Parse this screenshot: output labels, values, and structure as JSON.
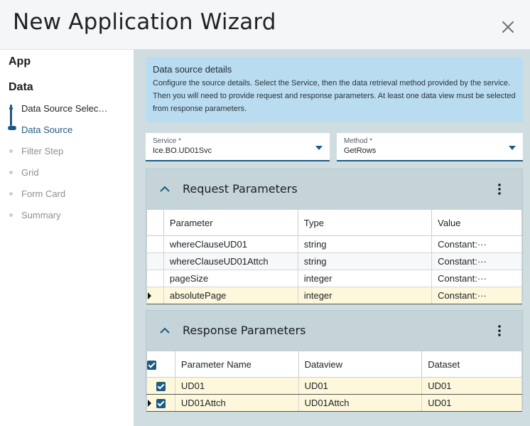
{
  "window": {
    "title": "New Application Wizard"
  },
  "sidebar": {
    "sections": [
      "App",
      "Data"
    ],
    "steps": [
      {
        "label": "Data Source Selec…",
        "state": "done"
      },
      {
        "label": "Data Source",
        "state": "active"
      },
      {
        "label": "Filter Step",
        "state": "pending"
      },
      {
        "label": "Grid",
        "state": "pending"
      },
      {
        "label": "Form Card",
        "state": "pending"
      },
      {
        "label": "Summary",
        "state": "pending"
      }
    ]
  },
  "info": {
    "heading": "Data source details",
    "body": "Configure the source details. Select the Service, then the data retrieval method provided by the service. Then you will need to provide request and response parameters. At least one data view must be selected from response parameters."
  },
  "service": {
    "label": "Service *",
    "value": "Ice.BO.UD01Svc"
  },
  "method": {
    "label": "Method *",
    "value": "GetRows"
  },
  "request": {
    "title": "Request Parameters",
    "columns": [
      "Parameter",
      "Type",
      "Value"
    ],
    "rows": [
      {
        "parameter": "whereClauseUD01",
        "type": "string",
        "value": "Constant:···"
      },
      {
        "parameter": "whereClauseUD01Attch",
        "type": "string",
        "value": "Constant:···"
      },
      {
        "parameter": "pageSize",
        "type": "integer",
        "value": "Constant:···"
      },
      {
        "parameter": "absolutePage",
        "type": "integer",
        "value": "Constant:···"
      }
    ]
  },
  "response": {
    "title": "Response Parameters",
    "columns": [
      "Parameter Name",
      "Dataview",
      "Dataset"
    ],
    "rows": [
      {
        "name": "UD01",
        "dataview": "UD01",
        "dataset": "UD01",
        "checked": true
      },
      {
        "name": "UD01Attch",
        "dataview": "UD01Attch",
        "dataset": "UD01",
        "checked": true
      }
    ]
  },
  "colors": {
    "accent": "#1d5b82",
    "info_bg": "#b9dcf0",
    "panel_bg": "#cfdde1",
    "selected_row": "#fdf7dc"
  }
}
